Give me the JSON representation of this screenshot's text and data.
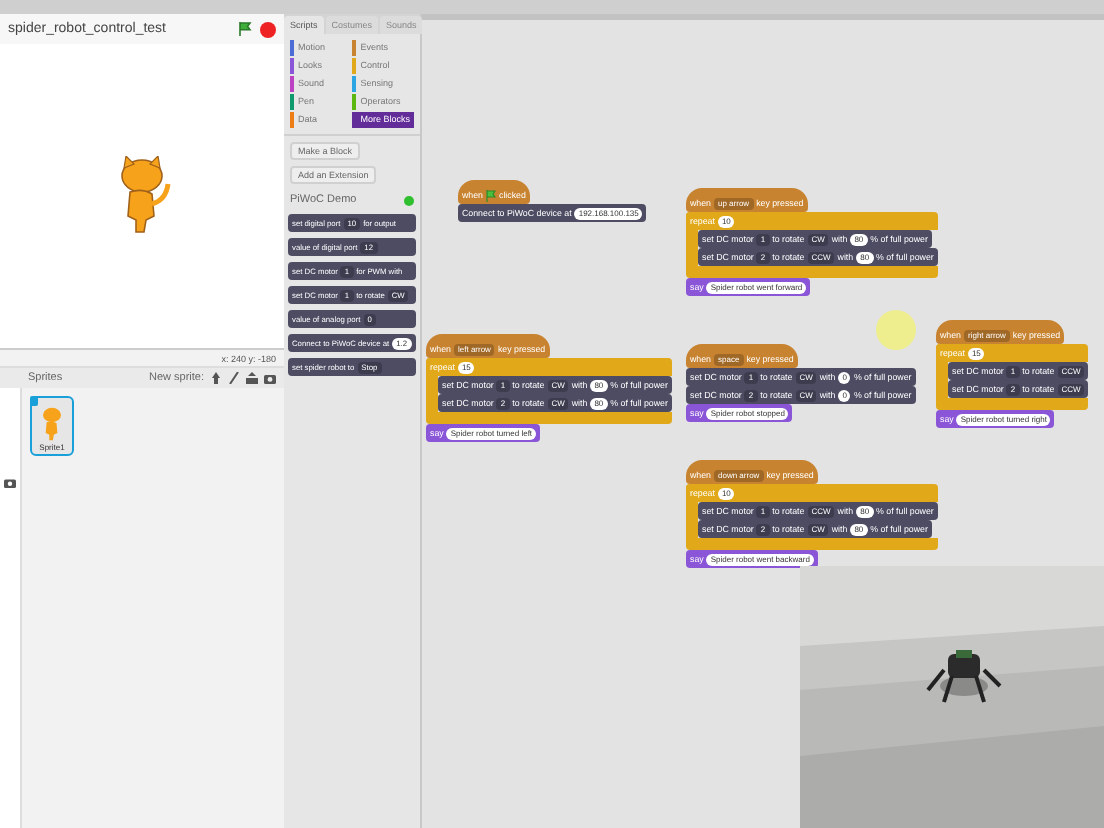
{
  "project": {
    "title": "spider_robot_control_test"
  },
  "stage": {
    "coordinates": "x: 240  y: -180"
  },
  "sprites": {
    "header": "Sprites",
    "new_sprite": "New sprite:",
    "items": [
      {
        "name": "Sprite1",
        "selected": true
      }
    ]
  },
  "tabs": [
    {
      "label": "Scripts",
      "selected": true
    },
    {
      "label": "Costumes",
      "selected": false
    },
    {
      "label": "Sounds",
      "selected": false
    }
  ],
  "categories": [
    {
      "label": "Motion",
      "color": "#4a6cd4",
      "selected": false
    },
    {
      "label": "Events",
      "color": "#c88330",
      "selected": false
    },
    {
      "label": "Looks",
      "color": "#8a55d7",
      "selected": false
    },
    {
      "label": "Control",
      "color": "#e1a91a",
      "selected": false
    },
    {
      "label": "Sound",
      "color": "#bb42c3",
      "selected": false
    },
    {
      "label": "Sensing",
      "color": "#2ca5e2",
      "selected": false
    },
    {
      "label": "Pen",
      "color": "#0e9a6c",
      "selected": false
    },
    {
      "label": "Operators",
      "color": "#5cb712",
      "selected": false
    },
    {
      "label": "Data",
      "color": "#ee7d16",
      "selected": false
    },
    {
      "label": "More Blocks",
      "color": "#632d99",
      "selected": true
    }
  ],
  "palette_buttons": [
    "Make a Block",
    "Add an Extension"
  ],
  "extension": {
    "name": "PiWoC Demo",
    "connected": true
  },
  "palette_blocks": [
    {
      "kind": "stack",
      "color": "#4d4c63",
      "parts": [
        {
          "kind": "label",
          "text": "set digital port"
        },
        {
          "kind": "menu",
          "text": "10"
        },
        {
          "kind": "label",
          "text": "for output"
        }
      ]
    },
    {
      "kind": "stack",
      "color": "#4d4c63",
      "parts": [
        {
          "kind": "label",
          "text": "value of digital port"
        },
        {
          "kind": "menu",
          "text": "12"
        }
      ]
    },
    {
      "kind": "stack",
      "color": "#4d4c63",
      "parts": [
        {
          "kind": "label",
          "text": "set DC motor"
        },
        {
          "kind": "menu",
          "text": "1"
        },
        {
          "kind": "label",
          "text": "for PWM with"
        }
      ]
    },
    {
      "kind": "stack",
      "color": "#4d4c63",
      "parts": [
        {
          "kind": "label",
          "text": "set DC motor"
        },
        {
          "kind": "menu",
          "text": "1"
        },
        {
          "kind": "label",
          "text": "to rotate"
        },
        {
          "kind": "menu",
          "text": "CW"
        }
      ]
    },
    {
      "kind": "stack",
      "color": "#4d4c63",
      "parts": [
        {
          "kind": "label",
          "text": "value of analog port"
        },
        {
          "kind": "menu",
          "text": "0"
        }
      ]
    },
    {
      "kind": "stack",
      "color": "#4d4c63",
      "parts": [
        {
          "kind": "label",
          "text": "Connect to PiWoC device at"
        },
        {
          "kind": "input",
          "text": "1.2"
        }
      ]
    },
    {
      "kind": "stack",
      "color": "#4d4c63",
      "parts": [
        {
          "kind": "label",
          "text": "set spider robot to"
        },
        {
          "kind": "menu",
          "text": "Stop"
        }
      ]
    }
  ],
  "scripts": [
    {
      "blocks": [
        {
          "kind": "hat",
          "color": "#c88330",
          "parts": [
            {
              "kind": "label",
              "text": "when"
            },
            {
              "kind": "flag"
            },
            {
              "kind": "label",
              "text": "clicked"
            }
          ]
        },
        {
          "kind": "stack",
          "color": "#4d4c63",
          "parts": [
            {
              "kind": "label",
              "text": "Connect to PiWoC device at"
            },
            {
              "kind": "input",
              "text": "192.168.100.135"
            }
          ]
        }
      ]
    },
    {
      "blocks": [
        {
          "kind": "hat",
          "color": "#c88330",
          "parts": [
            {
              "kind": "label",
              "text": "when"
            },
            {
              "kind": "menu",
              "text": "up arrow"
            },
            {
              "kind": "label",
              "text": "key pressed"
            }
          ]
        },
        {
          "kind": "c",
          "color": "#e1a91a",
          "parts": [
            {
              "kind": "label",
              "text": "repeat"
            },
            {
              "kind": "input",
              "text": "10"
            }
          ],
          "children": [
            {
              "kind": "stack",
              "color": "#4d4c63",
              "parts": [
                {
                  "kind": "label",
                  "text": "set DC motor"
                },
                {
                  "kind": "menu",
                  "text": "1"
                },
                {
                  "kind": "label",
                  "text": "to rotate"
                },
                {
                  "kind": "menu",
                  "text": "CW"
                },
                {
                  "kind": "label",
                  "text": "with"
                },
                {
                  "kind": "input",
                  "text": "80"
                },
                {
                  "kind": "label",
                  "text": "% of full power"
                }
              ]
            },
            {
              "kind": "stack",
              "color": "#4d4c63",
              "parts": [
                {
                  "kind": "label",
                  "text": "set DC motor"
                },
                {
                  "kind": "menu",
                  "text": "2"
                },
                {
                  "kind": "label",
                  "text": "to rotate"
                },
                {
                  "kind": "menu",
                  "text": "CCW"
                },
                {
                  "kind": "label",
                  "text": "with"
                },
                {
                  "kind": "input",
                  "text": "80"
                },
                {
                  "kind": "label",
                  "text": "% of full power"
                }
              ]
            }
          ]
        },
        {
          "kind": "stack",
          "color": "#8a55d7",
          "parts": [
            {
              "kind": "label",
              "text": "say"
            },
            {
              "kind": "input",
              "text": "Spider robot went forward"
            }
          ]
        }
      ]
    },
    {
      "blocks": [
        {
          "kind": "hat",
          "color": "#c88330",
          "parts": [
            {
              "kind": "label",
              "text": "when"
            },
            {
              "kind": "menu",
              "text": "left arrow"
            },
            {
              "kind": "label",
              "text": "key pressed"
            }
          ]
        },
        {
          "kind": "c",
          "color": "#e1a91a",
          "parts": [
            {
              "kind": "label",
              "text": "repeat"
            },
            {
              "kind": "input",
              "text": "15"
            }
          ],
          "children": [
            {
              "kind": "stack",
              "color": "#4d4c63",
              "parts": [
                {
                  "kind": "label",
                  "text": "set DC motor"
                },
                {
                  "kind": "menu",
                  "text": "1"
                },
                {
                  "kind": "label",
                  "text": "to rotate"
                },
                {
                  "kind": "menu",
                  "text": "CW"
                },
                {
                  "kind": "label",
                  "text": "with"
                },
                {
                  "kind": "input",
                  "text": "80"
                },
                {
                  "kind": "label",
                  "text": "% of full power"
                }
              ]
            },
            {
              "kind": "stack",
              "color": "#4d4c63",
              "parts": [
                {
                  "kind": "label",
                  "text": "set DC motor"
                },
                {
                  "kind": "menu",
                  "text": "2"
                },
                {
                  "kind": "label",
                  "text": "to rotate"
                },
                {
                  "kind": "menu",
                  "text": "CW"
                },
                {
                  "kind": "label",
                  "text": "with"
                },
                {
                  "kind": "input",
                  "text": "80"
                },
                {
                  "kind": "label",
                  "text": "% of full power"
                }
              ]
            }
          ]
        },
        {
          "kind": "stack",
          "color": "#8a55d7",
          "parts": [
            {
              "kind": "label",
              "text": "say"
            },
            {
              "kind": "input",
              "text": "Spider robot turned left"
            }
          ]
        }
      ]
    },
    {
      "blocks": [
        {
          "kind": "hat",
          "color": "#c88330",
          "parts": [
            {
              "kind": "label",
              "text": "when"
            },
            {
              "kind": "menu",
              "text": "space"
            },
            {
              "kind": "label",
              "text": "key pressed"
            }
          ]
        },
        {
          "kind": "stack",
          "color": "#4d4c63",
          "parts": [
            {
              "kind": "label",
              "text": "set DC motor"
            },
            {
              "kind": "menu",
              "text": "1"
            },
            {
              "kind": "label",
              "text": "to rotate"
            },
            {
              "kind": "menu",
              "text": "CW"
            },
            {
              "kind": "label",
              "text": "with"
            },
            {
              "kind": "input",
              "text": "0"
            },
            {
              "kind": "label",
              "text": "% of full power"
            }
          ]
        },
        {
          "kind": "stack",
          "color": "#4d4c63",
          "parts": [
            {
              "kind": "label",
              "text": "set DC motor"
            },
            {
              "kind": "menu",
              "text": "2"
            },
            {
              "kind": "label",
              "text": "to rotate"
            },
            {
              "kind": "menu",
              "text": "CW"
            },
            {
              "kind": "label",
              "text": "with"
            },
            {
              "kind": "input",
              "text": "0"
            },
            {
              "kind": "label",
              "text": "% of full power"
            }
          ]
        },
        {
          "kind": "stack",
          "color": "#8a55d7",
          "parts": [
            {
              "kind": "label",
              "text": "say"
            },
            {
              "kind": "input",
              "text": "Spider robot stopped"
            }
          ]
        }
      ]
    },
    {
      "blocks": [
        {
          "kind": "hat",
          "color": "#c88330",
          "parts": [
            {
              "kind": "label",
              "text": "when"
            },
            {
              "kind": "menu",
              "text": "right arrow"
            },
            {
              "kind": "label",
              "text": "key pressed"
            }
          ]
        },
        {
          "kind": "c",
          "color": "#e1a91a",
          "parts": [
            {
              "kind": "label",
              "text": "repeat"
            },
            {
              "kind": "input",
              "text": "15"
            }
          ],
          "children": [
            {
              "kind": "stack",
              "color": "#4d4c63",
              "parts": [
                {
                  "kind": "label",
                  "text": "set DC motor"
                },
                {
                  "kind": "menu",
                  "text": "1"
                },
                {
                  "kind": "label",
                  "text": "to rotate"
                },
                {
                  "kind": "menu",
                  "text": "CCW"
                }
              ]
            },
            {
              "kind": "stack",
              "color": "#4d4c63",
              "parts": [
                {
                  "kind": "label",
                  "text": "set DC motor"
                },
                {
                  "kind": "menu",
                  "text": "2"
                },
                {
                  "kind": "label",
                  "text": "to rotate"
                },
                {
                  "kind": "menu",
                  "text": "CCW"
                }
              ]
            }
          ]
        },
        {
          "kind": "stack",
          "color": "#8a55d7",
          "parts": [
            {
              "kind": "label",
              "text": "say"
            },
            {
              "kind": "input",
              "text": "Spider robot turned right"
            }
          ]
        }
      ]
    },
    {
      "blocks": [
        {
          "kind": "hat",
          "color": "#c88330",
          "parts": [
            {
              "kind": "label",
              "text": "when"
            },
            {
              "kind": "menu",
              "text": "down arrow"
            },
            {
              "kind": "label",
              "text": "key pressed"
            }
          ]
        },
        {
          "kind": "c",
          "color": "#e1a91a",
          "parts": [
            {
              "kind": "label",
              "text": "repeat"
            },
            {
              "kind": "input",
              "text": "10"
            }
          ],
          "children": [
            {
              "kind": "stack",
              "color": "#4d4c63",
              "parts": [
                {
                  "kind": "label",
                  "text": "set DC motor"
                },
                {
                  "kind": "menu",
                  "text": "1"
                },
                {
                  "kind": "label",
                  "text": "to rotate"
                },
                {
                  "kind": "menu",
                  "text": "CCW"
                },
                {
                  "kind": "label",
                  "text": "with"
                },
                {
                  "kind": "input",
                  "text": "80"
                },
                {
                  "kind": "label",
                  "text": "% of full power"
                }
              ]
            },
            {
              "kind": "stack",
              "color": "#4d4c63",
              "parts": [
                {
                  "kind": "label",
                  "text": "set DC motor"
                },
                {
                  "kind": "menu",
                  "text": "2"
                },
                {
                  "kind": "label",
                  "text": "to rotate"
                },
                {
                  "kind": "menu",
                  "text": "CW"
                },
                {
                  "kind": "label",
                  "text": "with"
                },
                {
                  "kind": "input",
                  "text": "80"
                },
                {
                  "kind": "label",
                  "text": "% of full power"
                }
              ]
            }
          ]
        },
        {
          "kind": "stack",
          "color": "#8a55d7",
          "parts": [
            {
              "kind": "label",
              "text": "say"
            },
            {
              "kind": "input",
              "text": "Spider robot went backward"
            }
          ]
        }
      ]
    }
  ],
  "video": {
    "kind": "picture"
  }
}
